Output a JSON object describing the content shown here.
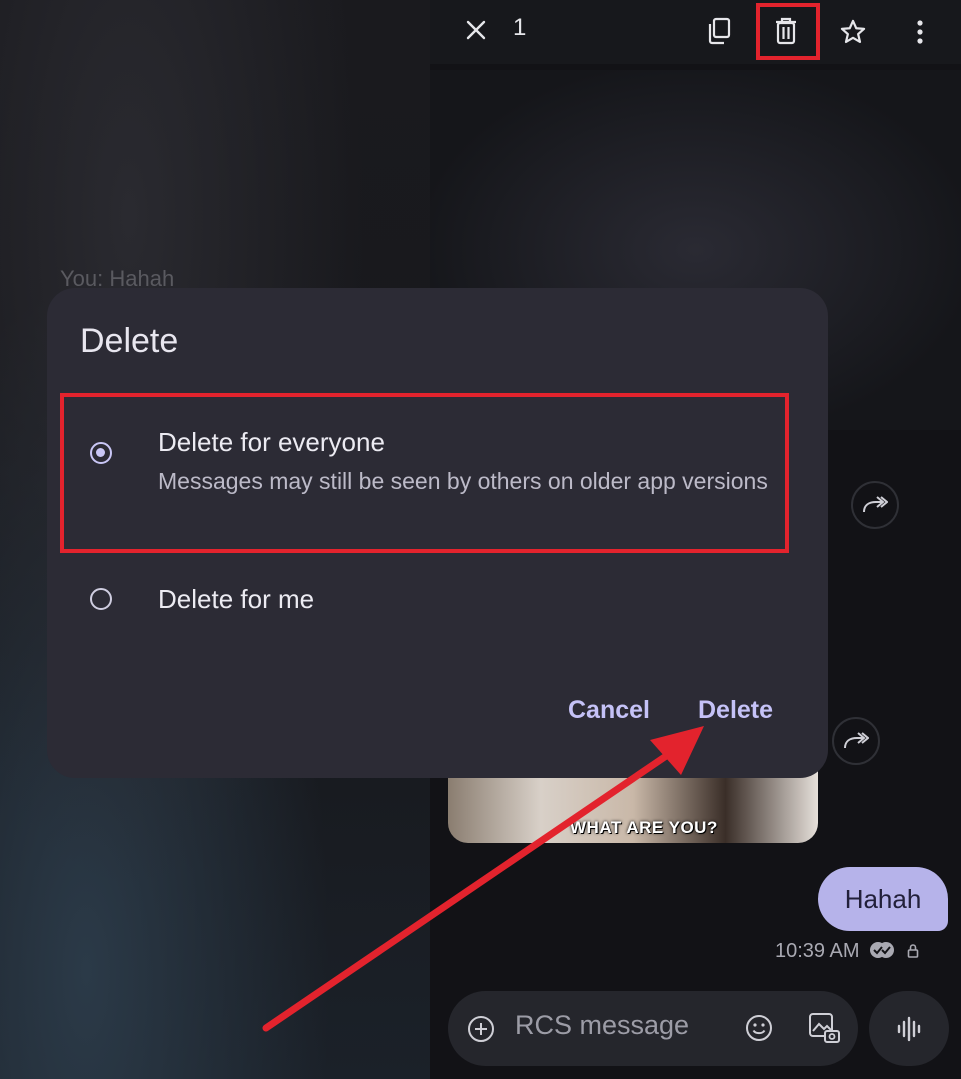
{
  "top_bar": {
    "selected_count": "1",
    "icons": [
      "close-icon",
      "copy-icon",
      "trash-icon",
      "star-icon",
      "more-vert-icon"
    ]
  },
  "background": {
    "faded_preview": "You: Hahah"
  },
  "dialog": {
    "title": "Delete",
    "options": [
      {
        "label": "Delete for everyone",
        "description": "Messages may still be seen by others on older app versions",
        "selected": true
      },
      {
        "label": "Delete for me",
        "selected": false
      }
    ],
    "cancel_label": "Cancel",
    "delete_label": "Delete"
  },
  "conversation": {
    "image_caption": "WHAT ARE YOU?",
    "bubble_text": "Hahah",
    "timestamp": "10:39 AM"
  },
  "composer": {
    "placeholder": "RCS message"
  },
  "colors": {
    "accent": "#c5c2f7",
    "highlight": "#e3232d",
    "dialog_bg": "#2c2b35",
    "bubble": "#b6b3ea"
  }
}
